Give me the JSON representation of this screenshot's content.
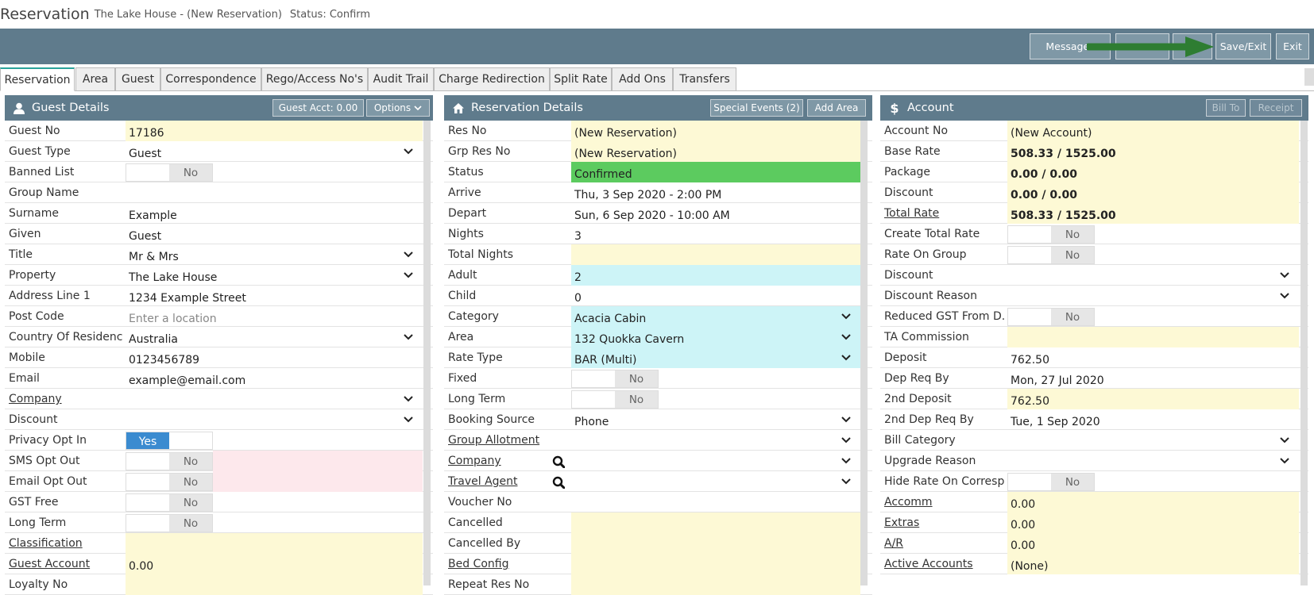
{
  "title": {
    "main": "Reservation",
    "sub": "The Lake House - (New Reservation)",
    "status": "Status: Confirm"
  },
  "toolbar": {
    "messages": "Messages",
    "btn2": "",
    "btn3": "",
    "save_exit": "Save/Exit",
    "exit": "Exit"
  },
  "tabs": [
    "Reservation",
    "Area",
    "Guest",
    "Correspondence",
    "Rego/Access No's",
    "Audit Trail",
    "Charge Redirection",
    "Split Rate",
    "Add Ons",
    "Transfers"
  ],
  "guest": {
    "title": "Guest Details",
    "acct_btn": "Guest Acct: 0.00",
    "options_btn": "Options",
    "rows": [
      {
        "label": "Guest No",
        "value": "17186"
      },
      {
        "label": "Guest Type",
        "value": "Guest"
      },
      {
        "label": "Banned List",
        "value": "No"
      },
      {
        "label": "Group Name",
        "value": ""
      },
      {
        "label": "Surname",
        "value": "Example"
      },
      {
        "label": "Given",
        "value": "Guest"
      },
      {
        "label": "Title",
        "value": "Mr & Mrs"
      },
      {
        "label": "Property",
        "value": "The Lake House"
      },
      {
        "label": "Address Line 1",
        "value": "1234 Example Street"
      },
      {
        "label": "Post Code",
        "value": "Enter a location"
      },
      {
        "label": "Country Of Residence",
        "value": "Australia"
      },
      {
        "label": "Mobile",
        "value": "0123456789"
      },
      {
        "label": "Email",
        "value": "example@email.com"
      },
      {
        "label": "Company",
        "value": ""
      },
      {
        "label": "Discount",
        "value": ""
      },
      {
        "label": "Privacy Opt In",
        "value": "Yes"
      },
      {
        "label": "SMS Opt Out",
        "value": "No"
      },
      {
        "label": "Email Opt Out",
        "value": "No"
      },
      {
        "label": "GST Free",
        "value": "No"
      },
      {
        "label": "Long Term",
        "value": "No"
      },
      {
        "label": "Classification",
        "value": ""
      },
      {
        "label": "Guest Account",
        "value": "0.00"
      },
      {
        "label": "Loyalty No",
        "value": ""
      }
    ]
  },
  "res": {
    "title": "Reservation Details",
    "special_btn": "Special Events (2)",
    "area_btn": "Add Area",
    "rows": [
      {
        "label": "Res No",
        "value": "(New Reservation)"
      },
      {
        "label": "Grp Res No",
        "value": "(New Reservation)"
      },
      {
        "label": "Status",
        "value": "Confirmed"
      },
      {
        "label": "Arrive",
        "value": "Thu, 3 Sep 2020 - 2:00 PM"
      },
      {
        "label": "Depart",
        "value": "Sun, 6 Sep 2020 - 10:00 AM"
      },
      {
        "label": "Nights",
        "value": "3"
      },
      {
        "label": "Total Nights",
        "value": ""
      },
      {
        "label": "Adult",
        "value": "2"
      },
      {
        "label": "Child",
        "value": "0"
      },
      {
        "label": "Category",
        "value": "Acacia Cabin"
      },
      {
        "label": "Area",
        "value": "132 Quokka Cavern"
      },
      {
        "label": "Rate Type",
        "value": "BAR (Multi)"
      },
      {
        "label": "Fixed",
        "value": "No"
      },
      {
        "label": "Long Term",
        "value": "No"
      },
      {
        "label": "Booking Source",
        "value": "Phone"
      },
      {
        "label": "Group Allotment",
        "value": ""
      },
      {
        "label": "Company",
        "value": ""
      },
      {
        "label": "Travel Agent",
        "value": ""
      },
      {
        "label": "Voucher No",
        "value": ""
      },
      {
        "label": "Cancelled",
        "value": ""
      },
      {
        "label": "Cancelled By",
        "value": ""
      },
      {
        "label": "Bed Config",
        "value": ""
      },
      {
        "label": "Repeat Res No",
        "value": ""
      }
    ]
  },
  "acct": {
    "title": "Account",
    "bill_btn": "Bill To",
    "receipt_btn": "Receipt",
    "rows": [
      {
        "label": "Account No",
        "value": "(New Account)"
      },
      {
        "label": "Base Rate",
        "value": "508.33 / 1525.00"
      },
      {
        "label": "Package",
        "value": "0.00 / 0.00"
      },
      {
        "label": "Discount",
        "value": "0.00 / 0.00"
      },
      {
        "label": "Total Rate",
        "value": "508.33 / 1525.00"
      },
      {
        "label": "Create Total Rate",
        "value": "No"
      },
      {
        "label": "Rate On Group",
        "value": "No"
      },
      {
        "label": "Discount",
        "value": ""
      },
      {
        "label": "Discount Reason",
        "value": ""
      },
      {
        "label": "Reduced GST From D...",
        "value": "No"
      },
      {
        "label": "TA Commission",
        "value": ""
      },
      {
        "label": "Deposit",
        "value": "762.50"
      },
      {
        "label": "Dep Req By",
        "value": "Mon, 27 Jul 2020"
      },
      {
        "label": "2nd Deposit",
        "value": "762.50"
      },
      {
        "label": "2nd Dep Req By",
        "value": "Tue, 1 Sep 2020"
      },
      {
        "label": "Bill Category",
        "value": ""
      },
      {
        "label": "Upgrade Reason",
        "value": ""
      },
      {
        "label": "Hide Rate On Corresp...",
        "value": "No"
      },
      {
        "label": "Accomm",
        "value": "0.00"
      },
      {
        "label": "Extras",
        "value": "0.00"
      },
      {
        "label": "A/R",
        "value": "0.00"
      },
      {
        "label": "Active Accounts",
        "value": "(None)"
      }
    ]
  },
  "colors": {
    "header": "#5f7b8c",
    "yellow": "#fdf9d5",
    "green": "#5ccb5f",
    "cyan": "#cdf4f7",
    "arrow": "#2e7d32"
  },
  "icons": [
    "user-icon",
    "home-icon",
    "dollar-icon",
    "chevron-down-icon",
    "search-icon",
    "arrow-icon"
  ]
}
